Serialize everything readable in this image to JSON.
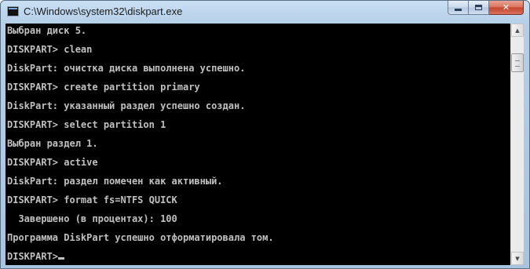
{
  "window": {
    "title": "C:\\Windows\\system32\\diskpart.exe",
    "icon": "console-app-icon"
  },
  "caption_buttons": {
    "minimize": "minimize-icon",
    "maximize": "maximize-icon",
    "close": "✕"
  },
  "console": {
    "lines": [
      "Выбран диск 5.",
      "DISKPART> clean",
      "DiskPart: очистка диска выполнена успешно.",
      "DISKPART> create partition primary",
      "DiskPart: указанный раздел успешно создан.",
      "DISKPART> select partition 1",
      "Выбран раздел 1.",
      "DISKPART> active",
      "DiskPart: раздел помечен как активный.",
      "DISKPART> format fs=NTFS QUICK",
      "  Завершено (в процентах): 100",
      "Программа DiskPart успешно отформатировала том.",
      "DISKPART>"
    ],
    "text_color": "#c0c0c0",
    "background_color": "#000000"
  },
  "scrollbar": {
    "up_arrow": "▲",
    "down_arrow": "▼"
  }
}
